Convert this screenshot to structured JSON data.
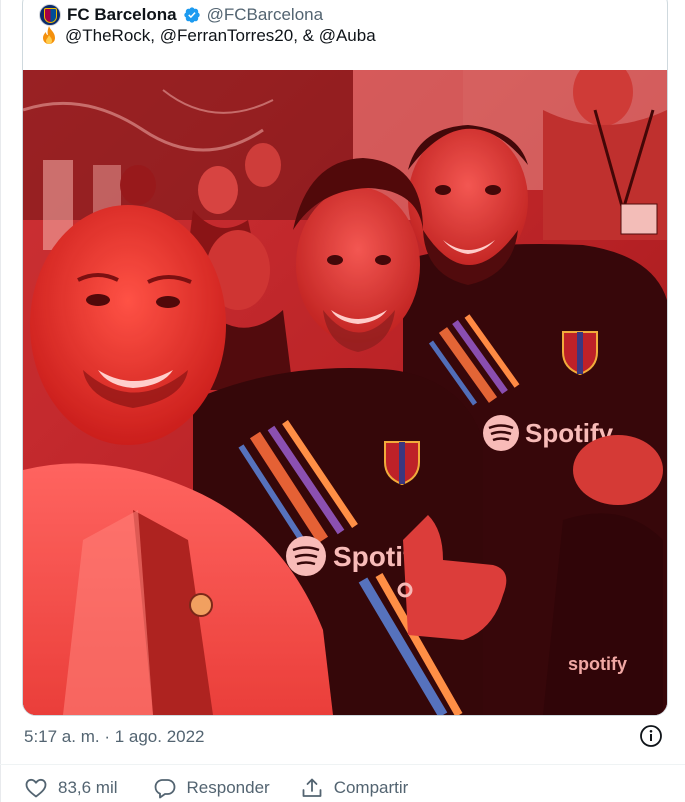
{
  "quoted_tweet": {
    "author_name": "FC Barcelona",
    "author_handle": "@FCBarcelona",
    "verified": true,
    "avatar_icon": "fc-barcelona-crest-icon",
    "text_emoji_icon": "fire-icon",
    "text": "@TheRock, @FerranTorres20, & @Auba",
    "photo_jersey_text": "Spotify"
  },
  "tweet": {
    "timestamp": "5:17 a. m. · 1 ago. 2022",
    "info_icon": "info-icon"
  },
  "actions": {
    "like_icon": "heart-icon",
    "like_count": "83,6 mil",
    "reply_icon": "reply-icon",
    "reply_label": "Responder",
    "share_icon": "share-icon",
    "share_label": "Compartir"
  },
  "colors": {
    "verified_blue": "#1d9bf0",
    "secondary_text": "#536471",
    "border": "#cfd9de",
    "photo_red_tint": "#d11b1f"
  }
}
